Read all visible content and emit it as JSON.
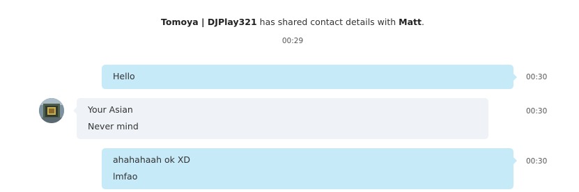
{
  "system_notice": {
    "sender": "Tomoya | DJPlay321",
    "action": "has shared contact details with",
    "recipient": "Matt",
    "trailing": ".",
    "time": "00:29"
  },
  "messages": [
    {
      "direction": "outgoing",
      "lines": [
        "Hello"
      ],
      "time": "00:30"
    },
    {
      "direction": "incoming",
      "lines": [
        "Your Asian",
        "Never mind"
      ],
      "time": "00:30"
    },
    {
      "direction": "outgoing",
      "lines": [
        "ahahahaah ok XD",
        "lmfao"
      ],
      "time": "00:30"
    }
  ],
  "colors": {
    "outgoing_bubble": "#c7eaf9",
    "incoming_bubble": "#eff2f6",
    "text": "#333333",
    "timestamp": "#555555"
  },
  "icons": {
    "contact_avatar": "avatar-photo-icon"
  }
}
